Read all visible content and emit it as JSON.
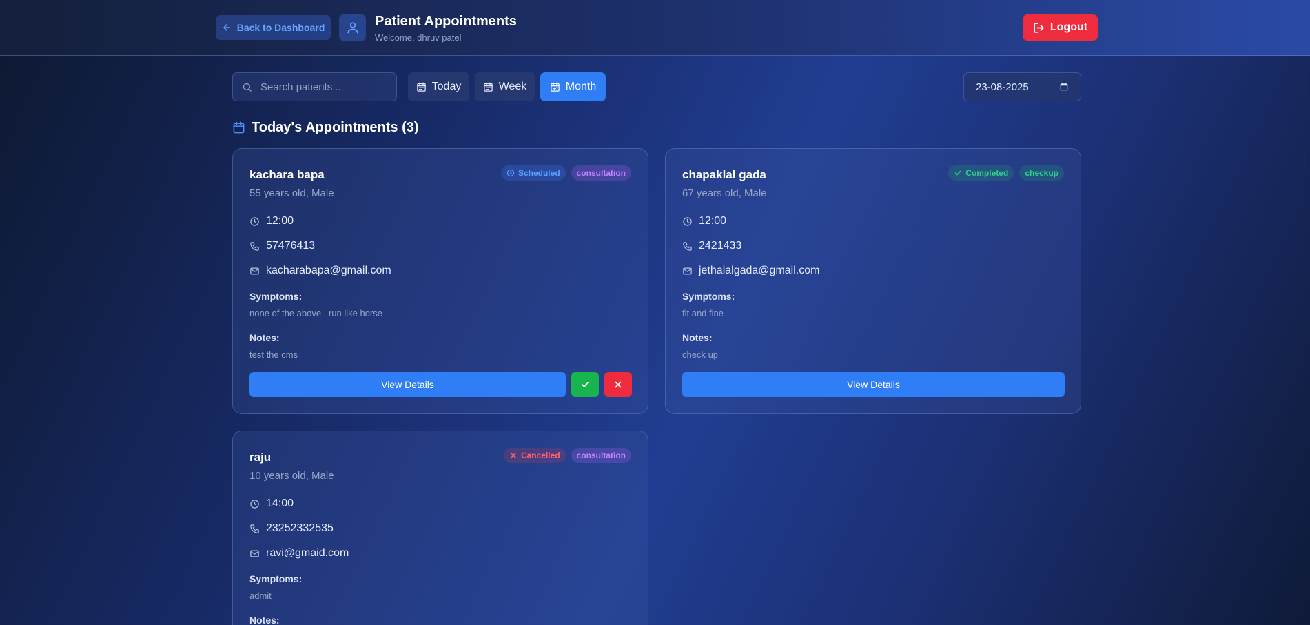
{
  "header": {
    "back_label": "Back to Dashboard",
    "title": "Patient Appointments",
    "welcome": "Welcome, dhruv patel",
    "logout_label": "Logout"
  },
  "toolbar": {
    "search_placeholder": "Search patients...",
    "filters": [
      "Today",
      "Week",
      "Month"
    ],
    "active_filter": "Month",
    "date_value": "23-08-2025"
  },
  "section": {
    "title": "Today's Appointments (3)"
  },
  "appointments": [
    {
      "name": "kachara bapa",
      "age_gender": "55 years old, Male",
      "status": "Scheduled",
      "type": "consultation",
      "time": "12:00",
      "phone": "57476413",
      "email": "kacharabapa@gmail.com",
      "symptoms_label": "Symptoms:",
      "symptoms": "none of the above . run like horse",
      "notes_label": "Notes:",
      "notes": "test the cms",
      "view_label": "View Details"
    },
    {
      "name": "chapaklal gada",
      "age_gender": "67 years old, Male",
      "status": "Completed",
      "type": "checkup",
      "time": "12:00",
      "phone": "2421433",
      "email": "jethalalgada@gmail.com",
      "symptoms_label": "Symptoms:",
      "symptoms": "fit and fine",
      "notes_label": "Notes:",
      "notes": "check up",
      "view_label": "View Details"
    },
    {
      "name": "raju",
      "age_gender": "10 years old, Male",
      "status": "Cancelled",
      "type": "consultation",
      "time": "14:00",
      "phone": "23252332535",
      "email": "ravi@gmaid.com",
      "symptoms_label": "Symptoms:",
      "symptoms": "admit",
      "notes_label": "Notes:"
    }
  ],
  "colors": {
    "accent": "#2f7ef6",
    "danger": "#ef2b3e",
    "success": "#18b54f"
  }
}
